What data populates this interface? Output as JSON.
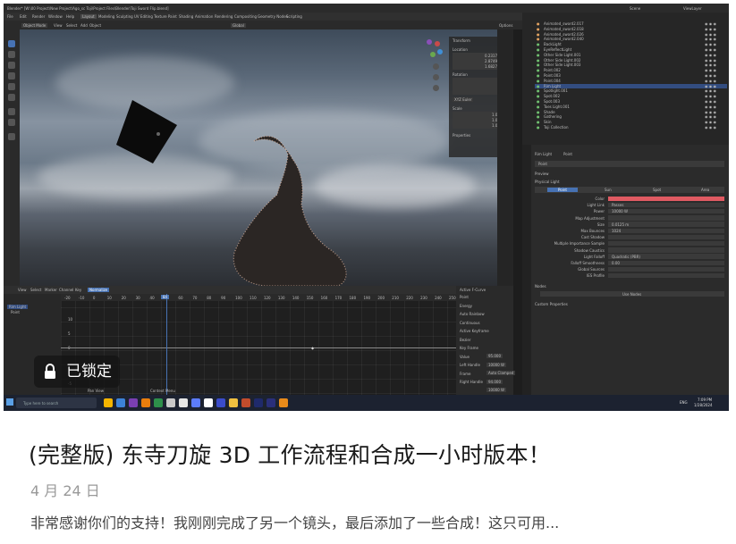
{
  "card": {
    "lock_label": "已锁定",
    "title": "(完整版) 东寺刀旋 3D 工作流程和合成一小时版本！",
    "date": "4 月 24 日",
    "excerpt": "非常感谢你们的支持！我刚刚完成了另一个镜头，最后添加了一些合成！这只可用..."
  },
  "blender": {
    "window_title": "Blender* [W:\\00 Project\\New Project\\Ago_sc Toji\\Project Files\\Blender\\Toji Sword Flip.blend]",
    "menu": [
      "File",
      "Edit",
      "Render",
      "Window",
      "Help"
    ],
    "workspaces": [
      "Layout",
      "Modeling",
      "Sculpting",
      "UV Editing",
      "Texture Paint",
      "Shading",
      "Animation",
      "Rendering",
      "Compositing",
      "Geometry Nodes",
      "Scripting"
    ],
    "header": [
      "Object Mode",
      "View",
      "Select",
      "Add",
      "Object"
    ],
    "transform_orientation": "Global",
    "scene": "Scene",
    "view_layer": "ViewLayer",
    "options_label": "Options",
    "npanel": {
      "transform_title": "Transform",
      "location_label": "Location",
      "location": [
        "0.23174 m",
        "2.87495 m",
        "1.6827 m"
      ],
      "rotation_label": "Rotation",
      "rotation": [
        "0°",
        "0°",
        "0°"
      ],
      "mode": "XYZ Euler",
      "scale_label": "Scale",
      "scale": [
        "1.000",
        "1.000",
        "1.000"
      ],
      "properties_label": "Properties"
    },
    "timeline": {
      "menu": [
        "View",
        "Select",
        "Marker",
        "Channel",
        "Key"
      ],
      "mode": "Normalize",
      "frames": [
        "-20",
        "-10",
        "0",
        "10",
        "20",
        "30",
        "40",
        "50",
        "60",
        "70",
        "80",
        "90",
        "100",
        "110",
        "120",
        "130",
        "140",
        "150",
        "160",
        "170",
        "180",
        "190",
        "200",
        "210",
        "220",
        "230",
        "240",
        "250"
      ],
      "current_frame": "84",
      "channels": [
        "Rim Light",
        "Point"
      ],
      "yticks": [
        "10",
        "5",
        "0",
        "-5"
      ],
      "status_left": "Set to Active Modifier",
      "status_mid": "Pan View",
      "status_right": "Context Menu"
    },
    "key_panel": {
      "title": "Active F-Curve",
      "items": [
        "Point",
        "Energy",
        "Auto Rainbow",
        "Continuous",
        "Active Keyframe",
        "Bezier",
        "Key Frame",
        "Value",
        "Left Handle",
        "Frame",
        "Right Handle"
      ],
      "values": [
        "95.000",
        "10000 W",
        "Auto Clamped",
        "94.000",
        "10000 W",
        "Auto Clamped"
      ]
    },
    "outliner": {
      "items": [
        "Animated_sword2.017",
        "Animated_sword2.018",
        "Animated_sword2.026",
        "Animated_sword2.040",
        "BackLight",
        "EyeReflectLight",
        "Other Side Light.001",
        "Other Side Light.002",
        "Other Side Light.003",
        "Point.002",
        "Point.003",
        "Point.004",
        "Rim Light",
        "Spotlight.001",
        "Spot.002",
        "Spot.003",
        "Toes Light.001",
        "Shade",
        "Gathering",
        "Skin",
        "Toji Collection"
      ],
      "selected": "Rim Light"
    },
    "properties": {
      "breadcrumb": [
        "Rim Light",
        "Point"
      ],
      "datablock": "Point",
      "sections": [
        "Preview",
        "Physical Light",
        "Nodes",
        "Custom Properties"
      ],
      "type_tabs": [
        "Point",
        "Sun",
        "Spot",
        "Area"
      ],
      "rows": [
        {
          "label": "Color",
          "value": ""
        },
        {
          "label": "Light Link",
          "value": "Passes"
        },
        {
          "label": "Power",
          "value": "10000 W"
        },
        {
          "label": "Map Adjustment",
          "value": ""
        },
        {
          "label": "Size",
          "value": "0.0125 m"
        },
        {
          "label": "Max Bounces",
          "value": "1024"
        },
        {
          "label": "Cast Shadow",
          "value": ""
        },
        {
          "label": "Multiple Importance Sample",
          "value": ""
        },
        {
          "label": "Shadow Caustics",
          "value": ""
        },
        {
          "label": "Light Falloff",
          "value": "Quadratic (PBR)"
        },
        {
          "label": "Falloff Smoothness",
          "value": "0.00"
        },
        {
          "label": "Global Sources",
          "value": ""
        },
        {
          "label": "IES Profile",
          "value": ""
        }
      ],
      "use_nodes": "Use Nodes"
    },
    "taskbar": {
      "search": "Type here to search",
      "time": "7:09 PM",
      "date": "1/28/2024",
      "lang": "ENG"
    }
  },
  "colors": {
    "accent_blue": "#4772b3",
    "light_color_bar": "#e05a62",
    "selected_row": "#334d80"
  }
}
